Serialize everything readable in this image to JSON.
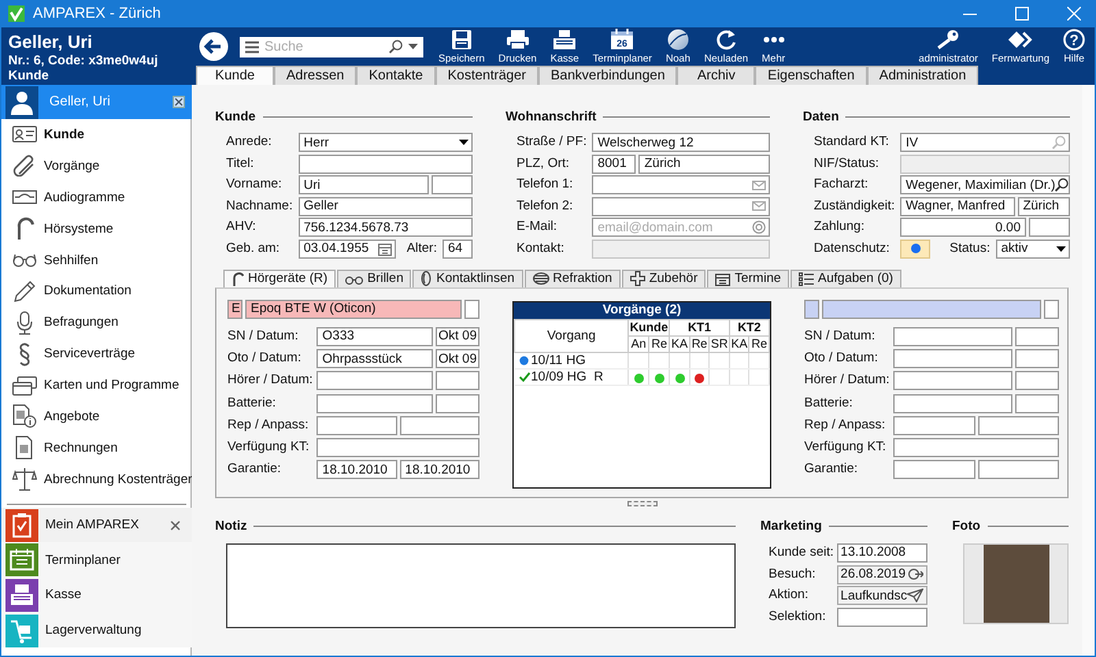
{
  "window": {
    "title": "AMPAREX - Zürich"
  },
  "customer_header": {
    "name": "Geller, Uri",
    "number": "Nr.: 6, Code: x3me0w4uj",
    "context": "Kunde"
  },
  "search": {
    "placeholder": "Suche"
  },
  "toolbar": [
    {
      "kind": "save",
      "label": "Speichern"
    },
    {
      "kind": "print",
      "label": "Drucken"
    },
    {
      "kind": "register",
      "label": "Kasse"
    },
    {
      "kind": "calendar",
      "label": "Terminplaner",
      "day": "26"
    },
    {
      "kind": "globe",
      "label": "Noah"
    },
    {
      "kind": "reload",
      "label": "Neuladen"
    },
    {
      "kind": "more",
      "label": "Mehr"
    }
  ],
  "user_tools": [
    {
      "kind": "key",
      "label": "administrator"
    },
    {
      "kind": "remote",
      "label": "Fernwartung"
    },
    {
      "kind": "help",
      "label": "Hilfe",
      "glyph": "?"
    }
  ],
  "tabs": [
    {
      "label": "Kunde",
      "selected": true
    },
    {
      "label": "Adressen",
      "selected": false
    },
    {
      "label": "Kontakte",
      "selected": false
    },
    {
      "label": "Kostenträger",
      "selected": false
    },
    {
      "label": "Bankverbindungen",
      "selected": false
    },
    {
      "label": "Archiv",
      "selected": false
    },
    {
      "label": "Eigenschaften",
      "selected": false
    },
    {
      "label": "Administration",
      "selected": false
    }
  ],
  "sidebar": {
    "customer": {
      "label": "Geller, Uri"
    },
    "items": [
      {
        "kind": "card",
        "label": "Kunde",
        "selected": true
      },
      {
        "kind": "clip",
        "label": "Vorgänge",
        "selected": false
      },
      {
        "kind": "audiogram",
        "label": "Audiogramme",
        "selected": false
      },
      {
        "kind": "ear",
        "label": "Hörsysteme",
        "selected": false
      },
      {
        "kind": "glasses",
        "label": "Sehhilfen",
        "selected": false
      },
      {
        "kind": "pencil",
        "label": "Dokumentation",
        "selected": false
      },
      {
        "kind": "mic",
        "label": "Befragungen",
        "selected": false
      },
      {
        "kind": "contract",
        "label": "Serviceverträge",
        "selected": false
      },
      {
        "kind": "cards",
        "label": "Karten und Programme",
        "selected": false
      },
      {
        "kind": "offer",
        "label": "Angebote",
        "selected": false
      },
      {
        "kind": "invoice",
        "label": "Rechnungen",
        "selected": false
      },
      {
        "kind": "scale",
        "label": "Abrechnung Kostenträger",
        "selected": false
      }
    ],
    "apps": [
      {
        "kind": "clipboard",
        "label": "Mein AMPAREX",
        "color": "#d8401c",
        "closable": true
      },
      {
        "kind": "calendar",
        "label": "Terminplaner",
        "color": "#4e8a1e",
        "closable": false
      },
      {
        "kind": "register",
        "label": "Kasse",
        "color": "#7b3fae",
        "closable": false
      },
      {
        "kind": "cart",
        "label": "Lagerverwaltung",
        "color": "#17b4c2",
        "closable": false
      }
    ]
  },
  "customer_form": {
    "title": "Kunde",
    "fields": [
      {
        "kind": "select",
        "label": "Anrede:",
        "value": "Herr",
        "disabled": false
      },
      {
        "kind": "text",
        "label": "Titel:",
        "disabled": false
      },
      {
        "kind": "text_extra",
        "label": "Vorname:",
        "value": "Uri",
        "disabled": false
      },
      {
        "kind": "text",
        "label": "Nachname:",
        "value": "Geller",
        "disabled": false
      },
      {
        "kind": "text",
        "label": "AHV:",
        "value": "756.1234.5678.73",
        "disabled": false
      },
      {
        "kind": "date_age",
        "label": "Geb. am:",
        "value": "03.04.1955",
        "age_label": "Alter:",
        "age": "64",
        "disabled": false
      }
    ]
  },
  "address": {
    "title": "Wohnanschrift",
    "fields": [
      {
        "kind": "text",
        "label": "Straße / PF:",
        "value": "Welscherweg 12",
        "disabled": false
      },
      {
        "kind": "pair",
        "label": "PLZ, Ort:",
        "values": [
          "8001",
          "Zürich"
        ],
        "disabled": false
      },
      {
        "kind": "phone",
        "label": "Telefon 1:",
        "disabled": false
      },
      {
        "kind": "phone",
        "label": "Telefon 2:",
        "disabled": false
      },
      {
        "kind": "email",
        "label": "E-Mail:",
        "placeholder": "email@domain.com",
        "disabled": false
      },
      {
        "kind": "text",
        "label": "Kontakt:",
        "disabled": true
      }
    ]
  },
  "data": {
    "title": "Daten",
    "fields": [
      {
        "kind": "lookup",
        "label": "Standard KT:",
        "value": "IV",
        "disabled": false
      },
      {
        "kind": "text",
        "label": "NIF/Status:",
        "disabled": true
      },
      {
        "kind": "lookup",
        "label": "Facharzt:",
        "value": "Wegener, Maximilian (Dr.)",
        "disabled": false
      },
      {
        "kind": "pair",
        "label": "Zuständigkeit:",
        "values": [
          "Wagner, Manfred",
          "Zürich"
        ],
        "disabled": false
      },
      {
        "kind": "number",
        "label": "Zahlung:",
        "value": "0.00",
        "disabled": false
      },
      {
        "kind": "privacy_status",
        "label": "Datenschutz:",
        "on": true,
        "status_label": "Status:",
        "status": "aktiv",
        "disabled": false
      }
    ]
  },
  "device_tabs": [
    {
      "kind": "ear",
      "label": "Hörgeräte (R)",
      "selected": true
    },
    {
      "kind": "glasses",
      "label": "Brillen",
      "selected": false
    },
    {
      "kind": "lens",
      "label": "Kontaktlinsen",
      "selected": false
    },
    {
      "kind": "refraction",
      "label": "Refraktion",
      "selected": false
    },
    {
      "kind": "plus",
      "label": "Zubehör",
      "selected": false
    },
    {
      "kind": "calendar",
      "label": "Termine",
      "selected": false
    },
    {
      "kind": "list",
      "label": "Aufgaben (0)",
      "selected": false
    }
  ],
  "hearing_aids": [
    {
      "color": "#f7b8b8",
      "code": "E",
      "model": "Epoq BTE W (Oticon)",
      "rows": [
        {
          "kind": "wide_small",
          "label": "SN / Datum:",
          "values": [
            "O333",
            "Okt 09"
          ]
        },
        {
          "kind": "wide_small",
          "label": "Oto / Datum:",
          "values": [
            "Ohrpassstück",
            "Okt 09"
          ]
        },
        {
          "kind": "wide_small",
          "label": "Hörer / Datum:"
        },
        {
          "kind": "wide_small",
          "label": "Batterie:"
        },
        {
          "kind": "halves",
          "label": "Rep / Anpass:"
        },
        {
          "kind": "full",
          "label": "Verfügung KT:"
        },
        {
          "kind": "halves",
          "label": "Garantie:",
          "values": [
            "18.10.2010",
            "18.10.2010"
          ]
        }
      ]
    },
    {
      "color": "#c8d2f4",
      "rows": [
        {
          "kind": "wide_small",
          "label": "SN / Datum:"
        },
        {
          "kind": "wide_small",
          "label": "Oto / Datum:"
        },
        {
          "kind": "wide_small",
          "label": "Hörer / Datum:"
        },
        {
          "kind": "wide_small",
          "label": "Batterie:"
        },
        {
          "kind": "halves",
          "label": "Rep / Anpass:"
        },
        {
          "kind": "full",
          "label": "Verfügung KT:"
        },
        {
          "kind": "halves",
          "label": "Garantie:"
        }
      ]
    }
  ],
  "procedures": {
    "title": "Vorgänge (2)",
    "first_column": "Vorgang",
    "groups": [
      {
        "label": "Kunde",
        "columns": [
          "An",
          "Re"
        ]
      },
      {
        "label": "KT1",
        "columns": [
          "KA",
          "Re",
          "SR"
        ]
      },
      {
        "label": "KT2",
        "columns": [
          "KA",
          "Re"
        ]
      }
    ],
    "rows": [
      {
        "kind": "open",
        "label": "10/11 HG",
        "cells": [
          {
            "dot": false
          },
          {
            "dot": false
          },
          {
            "dot": false
          },
          {
            "dot": false
          },
          {
            "dot": false
          },
          {
            "dot": false
          },
          {
            "dot": false
          }
        ]
      },
      {
        "kind": "done",
        "label": "10/09 HG  R",
        "cells": [
          {
            "dot": true,
            "color": "#2ecc2e"
          },
          {
            "dot": true,
            "color": "#2ecc2e"
          },
          {
            "dot": true,
            "color": "#2ecc2e"
          },
          {
            "dot": true,
            "color": "#dd2020"
          },
          {
            "dot": false
          },
          {
            "dot": false
          },
          {
            "dot": false
          }
        ]
      }
    ]
  },
  "notes": {
    "title": "Notiz"
  },
  "marketing": {
    "title": "Marketing",
    "fields": [
      {
        "kind": "text",
        "label": "Kunde seit:",
        "value": "13.10.2008"
      },
      {
        "kind": "visit",
        "label": "Besuch:",
        "value": "26.08.2019"
      },
      {
        "kind": "campaign",
        "label": "Aktion:",
        "value": "Laufkundsc"
      },
      {
        "kind": "text",
        "label": "Selektion:"
      }
    ]
  },
  "photo": {
    "title": "Foto"
  }
}
